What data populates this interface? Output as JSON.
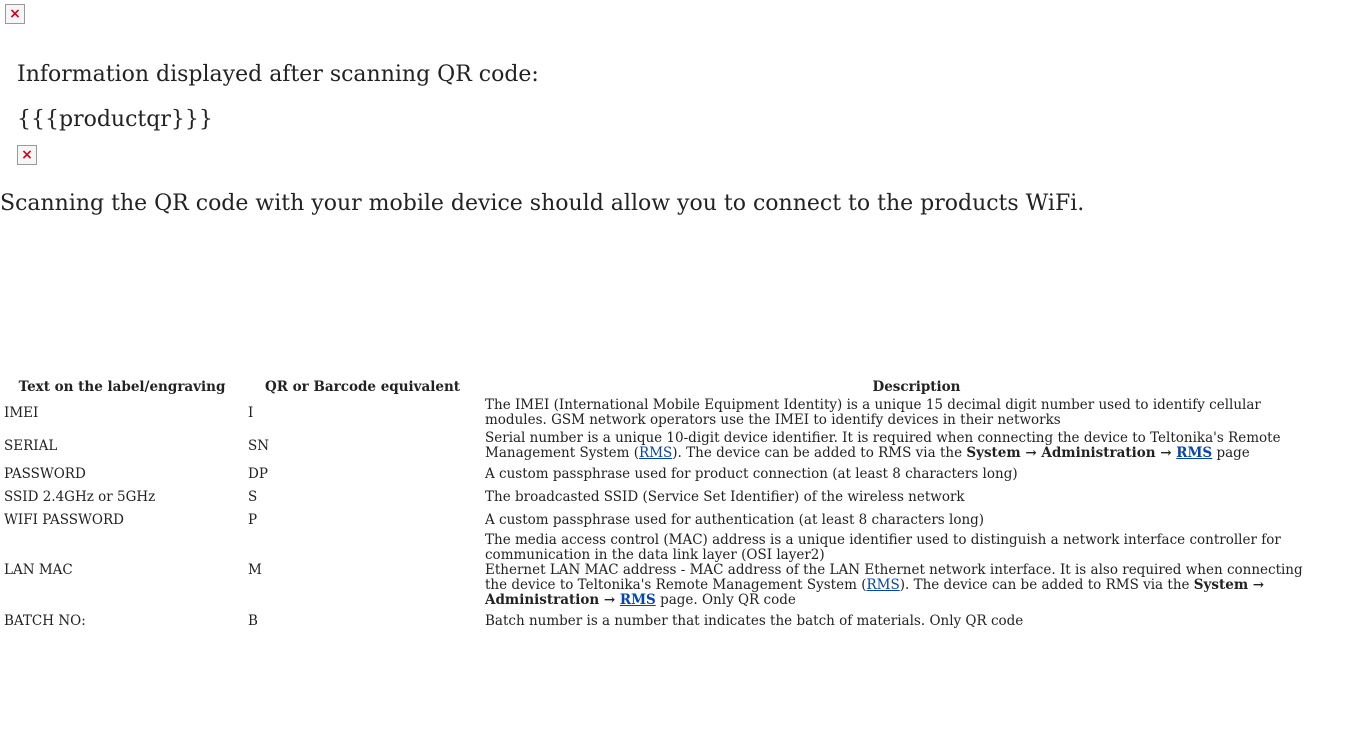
{
  "content": {
    "intro_text": "Information displayed after scanning QR code:",
    "template_text": "{{{productqr}}}",
    "wifi_text": "Scanning the QR code with your mobile device should allow you to connect to the products WiFi.",
    "broken_image_glyph": "×"
  },
  "table": {
    "headers": [
      "Text on the label/engraving",
      "QR or Barcode equivalent",
      "Description"
    ],
    "rows": [
      {
        "label": "IMEI",
        "code": "I",
        "desc": "The IMEI (International Mobile Equipment Identity) is a unique 15 decimal digit number used to identify cellular modules. GSM network operators use the IMEI to identify devices in their networks"
      },
      {
        "label": "SERIAL",
        "code": "SN",
        "desc_part1": "Serial number is a unique 10-digit device identifier. It is required when connecting the device to Teltonika's Remote Management System (",
        "desc_link": "RMS",
        "desc_part2": "). The device can be added to RMS via the ",
        "desc_bold": "System → Administration → ",
        "desc_bold_link": "RMS",
        "desc_part3": " page"
      },
      {
        "label": "PASSWORD",
        "code": "DP",
        "desc": "A custom passphrase used for product connection (at least 8 characters long)"
      },
      {
        "label": "SSID 2.4GHz or 5GHz",
        "code": "S",
        "desc": "The broadcasted SSID (Service Set Identifier) of the wireless network"
      },
      {
        "label": "WIFI PASSWORD",
        "code": "P",
        "desc": "A custom passphrase used for authentication (at least 8 characters long)"
      },
      {
        "label": "LAN MAC",
        "code": "M",
        "desc_line1": "The media access control (MAC) address is a unique identifier used to distinguish a network interface controller for communication in the data link layer (OSI layer2)",
        "desc_part1": "Ethernet LAN MAC address - MAC address of the LAN Ethernet network interface. It is also required when connecting the device to Teltonika's Remote Management System (",
        "desc_link": "RMS",
        "desc_part2": "). The device can be added to RMS via the ",
        "desc_bold": "System → Administration → ",
        "desc_bold_link": "RMS",
        "desc_part3": " page. Only QR code"
      },
      {
        "label": "BATCH NO:",
        "code": "B",
        "desc": "Batch number is a number that indicates the batch of materials. Only QR code"
      }
    ]
  }
}
